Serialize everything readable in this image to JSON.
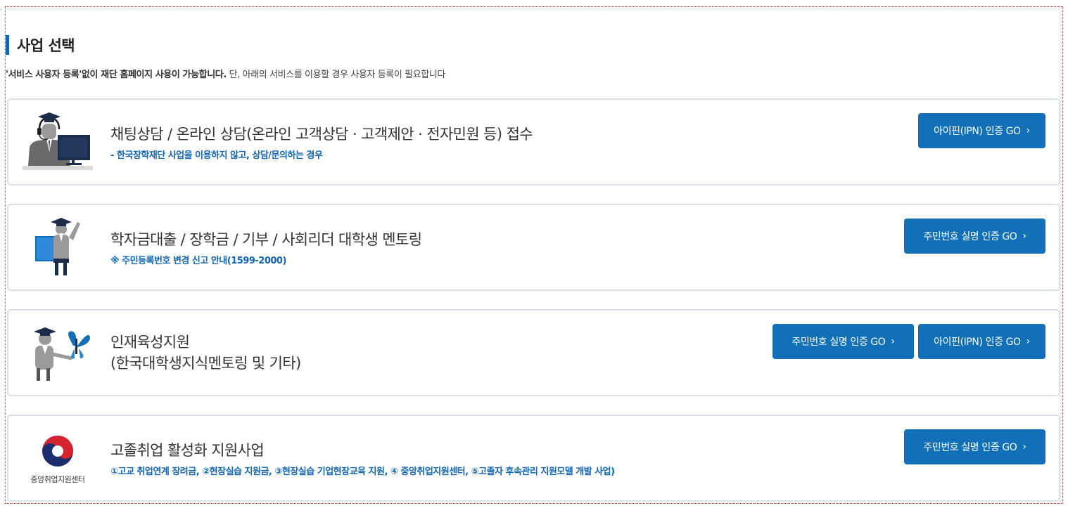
{
  "header": {
    "title": "사업 선택",
    "notice_bold": "'서비스 사용자 등록'없이 재단 홈페이지 사용이 가능합니다.",
    "notice_rest": " 단, 아래의 서비스를 이용할 경우 사용자 등록이 필요합니다"
  },
  "cards": [
    {
      "icon": "counselor-headset-icon",
      "title": "채팅상담 / 온라인 상담(온라인 고객상담 · 고객제안 · 전자민원 등) 접수",
      "sub": "- 한국장학재단 사업을 이용하지 않고, 상담/문의하는 경우",
      "buttons": [
        "아이핀(IPN) 인증 GO"
      ]
    },
    {
      "icon": "graduate-book-icon",
      "title": "학자금대출 / 장학금 / 기부 / 사회리더 대학생 멘토링",
      "sub": "※ 주민등록번호 변경 신고 안내(1599-2000)",
      "buttons": [
        "주민번호 실명 인증 GO"
      ]
    },
    {
      "icon": "graduate-butterfly-icon",
      "title_line1": "인재육성지원",
      "title_line2": "(한국대학생지식멘토링 및 기타)",
      "buttons": [
        "주민번호 실명 인증 GO",
        "아이핀(IPN) 인증 GO"
      ]
    },
    {
      "icon": "taegeuk-logo-icon",
      "logo_text": "중앙취업지원센터",
      "title": "고졸취업 활성화 지원사업",
      "sub": "①고교 취업연계 장려금, ②현장실습 지원금, ③현장실습 기업현장교육 지원, ④ 중앙취업지원센터, ⑤고졸자 후속관리 지원모델 개발 사업)",
      "buttons": [
        "주민번호 실명 인증 GO"
      ]
    }
  ],
  "colors": {
    "accent": "#1170b8",
    "border": "#d9e1e8",
    "sub_text": "#1166b5"
  }
}
